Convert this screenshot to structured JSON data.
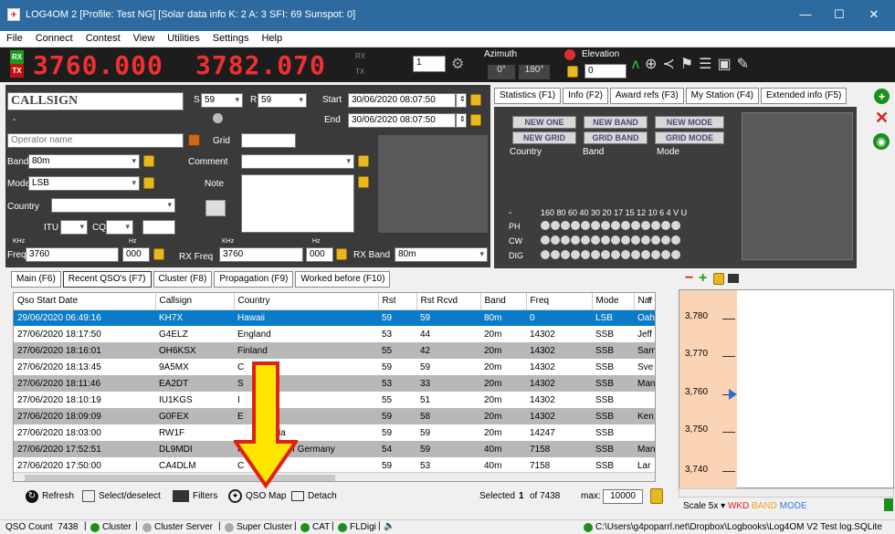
{
  "window": {
    "title": "LOG4OM 2 [Profile: Test NG] [Solar data info K: 2 A: 3 SFI: 69 Sunspot: 0]",
    "minimize": "—",
    "maximize": "☐",
    "close": "✕"
  },
  "menu": [
    "File",
    "Connect",
    "Contest",
    "View",
    "Utilities",
    "Settings",
    "Help"
  ],
  "toolbar": {
    "rx_label": "RX",
    "tx_label": "TX",
    "rx_freq": "3760.000",
    "tx_freq": "3782.070",
    "rx_small": "RX",
    "tx_small": "TX",
    "radio_num": "1",
    "azimuth_label": "Azimuth",
    "azimuth_value": "0°",
    "azimuth_dir": "180°",
    "elevation_label": "Elevation",
    "elevation_value": "0"
  },
  "qso": {
    "callsign_label": "CALLSIGN",
    "s_label": "S",
    "s_value": "59",
    "r_label": "R",
    "r_value": "59",
    "start_label": "Start",
    "start_value": "30/06/2020 08:07:50",
    "end_label": "End",
    "end_value": "30/06/2020 08:07:50",
    "dash": "-",
    "operator_placeholder": "Operator name",
    "grid_label": "Grid",
    "band_label": "Band",
    "band_value": "80m",
    "mode_label": "Mode",
    "mode_value": "LSB",
    "comment_label": "Comment",
    "note_label": "Note",
    "country_label": "Country",
    "itu_label": "ITU",
    "cq_label": "CQ",
    "khz_label": "KHz",
    "hz_label": "Hz",
    "freq_label": "Freq",
    "freq_value": "3760",
    "freq_hz": "000",
    "rxfreq_label": "RX Freq",
    "rxfreq_value": "3760",
    "rxfreq_hz": "000",
    "rxband_label": "RX Band",
    "rxband_value": "80m"
  },
  "stat_tabs": [
    "Statistics (F1)",
    "Info (F2)",
    "Award refs (F3)",
    "My Station (F4)",
    "Extended info (F5)"
  ],
  "stats": {
    "new_one": "NEW ONE",
    "new_band": "NEW BAND",
    "new_mode": "NEW MODE",
    "new_grid": "NEW GRID",
    "grid_band": "GRID BAND",
    "grid_mode": "GRID MODE",
    "country": "Country",
    "band": "Band",
    "mode": "Mode",
    "dash": "-",
    "bands_header": "160 80 60 40 30 20 17 15 12 10  6   4   V   U",
    "rows": [
      "PH",
      "CW",
      "DIG"
    ]
  },
  "lower_tabs": [
    "Main (F6)",
    "Recent QSO's (F7)",
    "Cluster (F8)",
    "Propagation (F9)",
    "Worked before (F10)"
  ],
  "table": {
    "headers": [
      "Qso Start Date",
      "Callsign",
      "Country",
      "Rst",
      "Rst Rcvd",
      "Band",
      "Freq",
      "Mode",
      "Nar"
    ],
    "rows": [
      [
        "29/06/2020 06:49:16",
        "KH7X",
        "Hawaii",
        "59",
        "59",
        "80m",
        "0",
        "LSB",
        "Oah"
      ],
      [
        "27/06/2020 18:17:50",
        "G4ELZ",
        "England",
        "53",
        "44",
        "20m",
        "14302",
        "SSB",
        "Jeff"
      ],
      [
        "27/06/2020 18:16:01",
        "OH6KSX",
        "Finland",
        "55",
        "42",
        "20m",
        "14302",
        "SSB",
        "Sam"
      ],
      [
        "27/06/2020 18:13:45",
        "9A5MX",
        "C",
        "59",
        "59",
        "20m",
        "14302",
        "SSB",
        "Sve"
      ],
      [
        "27/06/2020 18:11:46",
        "EA2DT",
        "S",
        "53",
        "33",
        "20m",
        "14302",
        "SSB",
        "Man"
      ],
      [
        "27/06/2020 18:10:19",
        "IU1KGS",
        "I",
        "55",
        "51",
        "20m",
        "14302",
        "SSB",
        ""
      ],
      [
        "27/06/2020 18:09:09",
        "G0FEX",
        "E",
        "59",
        "58",
        "20m",
        "14302",
        "SSB",
        "Ken"
      ],
      [
        "27/06/2020 18:03:00",
        "RW1F",
        "        Russia",
        "59",
        "59",
        "20m",
        "14247",
        "SSB",
        ""
      ],
      [
        "27/06/2020 17:52:51",
        "DL9MDI",
        "F     epublic of Germany",
        "54",
        "59",
        "40m",
        "7158",
        "SSB",
        "Man"
      ],
      [
        "27/06/2020 17:50:00",
        "CA4DLM",
        "C",
        "59",
        "53",
        "40m",
        "7158",
        "SSB",
        "Lar"
      ]
    ]
  },
  "bottom_toolbar": {
    "refresh": "Refresh",
    "select": "Select/deselect",
    "filters": "Filters",
    "qso_map": "QSO Map",
    "detach": "Detach",
    "selected_prefix": "Selected",
    "selected_num": "1",
    "selected_of": "of 7438",
    "max_label": "max:",
    "max_value": "10000"
  },
  "bandmap": {
    "ticks": [
      "3,780",
      "3,770",
      "3,760",
      "3,750",
      "3,740"
    ],
    "scale_label": "Scale 5x",
    "wkd": "WKD",
    "band": "BAND",
    "mode": "MODE"
  },
  "status": {
    "qso_count": "QSO Count  7438",
    "cluster": "Cluster",
    "cluster_server": "Cluster Server",
    "super_cluster": "Super Cluster",
    "cat": "CAT",
    "fldigi": "FLDigi",
    "path": "C:\\Users\\g4poparrl.net\\Dropbox\\Logbooks\\Log4OM V2 Test log.SQLite"
  },
  "colors": {
    "accent": "#0a7bc8",
    "freq": "#f03030",
    "arrow": "#ffe600"
  }
}
